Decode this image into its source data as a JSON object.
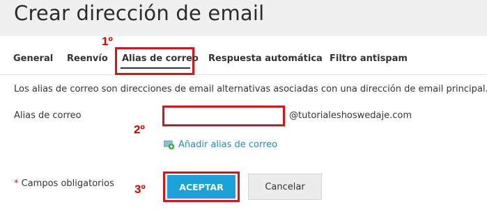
{
  "header": {
    "title": "Crear dirección de email"
  },
  "annotations": {
    "step1": "1º",
    "step2": "2º",
    "step3": "3º"
  },
  "tabs": [
    {
      "label": "General"
    },
    {
      "label": "Reenvío"
    },
    {
      "label": "Alias de correo"
    },
    {
      "label": "Respuesta automática"
    },
    {
      "label": "Filtro antispam"
    }
  ],
  "active_tab": "Alias de correo",
  "description": "Los alias de correo son direcciones de email alternativas asociadas con una dirección de email principal.",
  "form": {
    "alias_label": "Alias de correo",
    "alias_value": "",
    "domain_suffix": "@tutorialeshoswedaje.com",
    "add_alias_link": "Añadir alias de correo"
  },
  "footer": {
    "required_star": "*",
    "required_text": "Campos obligatorios",
    "ok_label": "ACEPTAR",
    "cancel_label": "Cancelar"
  },
  "colors": {
    "accent": "#1aa3d6",
    "highlight": "#d8141b",
    "link": "#1f8bbf"
  }
}
